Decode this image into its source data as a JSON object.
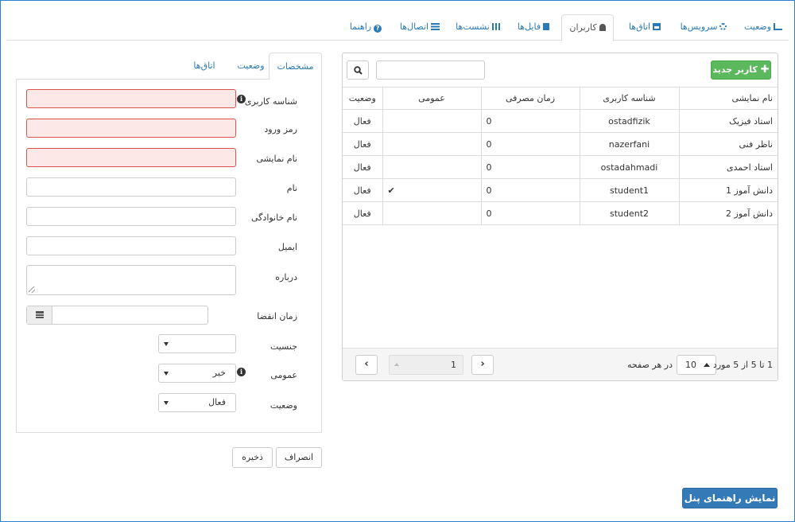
{
  "tabs": [
    {
      "label": "وضعیت",
      "icon": "bar-chart-icon"
    },
    {
      "label": "سرویس‌ها",
      "icon": "gear-icon"
    },
    {
      "label": "اتاق‌ها",
      "icon": "sitemap-icon"
    },
    {
      "label": "کاربران",
      "icon": "user-icon",
      "active": true
    },
    {
      "label": "فایل‌ها",
      "icon": "file-icon"
    },
    {
      "label": "نشست‌ها",
      "icon": "grid-icon"
    },
    {
      "label": "اتصال‌ها",
      "icon": "list-icon"
    },
    {
      "label": "راهنما",
      "icon": "question-circle-icon"
    }
  ],
  "users": {
    "new_user_label": "کاربر جدید",
    "search_value": "",
    "columns": [
      "نام نمایشی",
      "شناسه کاربری",
      "زمان مصرفی",
      "عمومی",
      "وضعیت"
    ],
    "rows": [
      {
        "name": "استاد فیزیک",
        "username": "ostadfizik",
        "time": "0",
        "public": "",
        "status": "فعال"
      },
      {
        "name": "ناظر فنی",
        "username": "nazerfani",
        "time": "0",
        "public": "",
        "status": "فعال"
      },
      {
        "name": "استاد احمدی",
        "username": "ostadahmadi",
        "time": "0",
        "public": "",
        "status": "فعال"
      },
      {
        "name": "دانش آموز 1",
        "username": "student1",
        "time": "0",
        "public": "✔",
        "status": "فعال"
      },
      {
        "name": "دانش آموز 2",
        "username": "student2",
        "time": "0",
        "public": "",
        "status": "فعال"
      }
    ],
    "pager": {
      "summary": "1 تا 5 از 5 مورد",
      "page_size": "10",
      "per_page_label": "در هر صفحه",
      "page": "1"
    }
  },
  "details": {
    "tabs": [
      "مشخصات",
      "وضعیت",
      "اتاق‌ها"
    ],
    "labels": {
      "username": "شناسه کاربری",
      "password": "رمز ورود",
      "display_name": "نام نمایشی",
      "first_name": "نام",
      "last_name": "نام خانوادگی",
      "email": "ایمیل",
      "about": "درباره",
      "expire": "زمان انقضا",
      "gender": "جنسیت",
      "public": "عمومی",
      "status": "وضعیت"
    },
    "values": {
      "gender": "",
      "public": "خیر",
      "status": "فعال"
    },
    "cancel_label": "انصراف",
    "save_label": "ذخیره"
  },
  "guide_button_label": "نمایش راهنمای پنل"
}
